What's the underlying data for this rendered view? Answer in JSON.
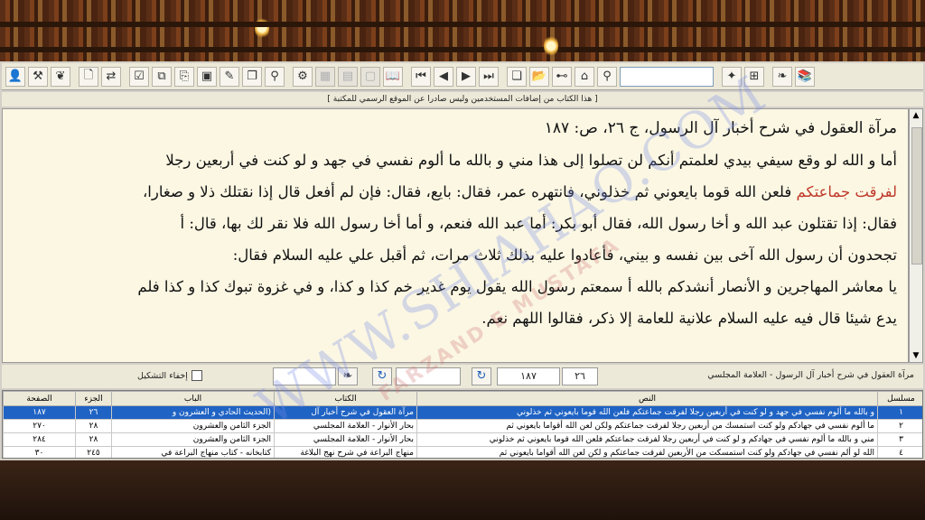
{
  "toolbar": {
    "icons": [
      "book-icon",
      "books-icon",
      "search-input-field",
      "pages-icon",
      "binoculars-icon",
      "grid-icon",
      "folder-icon",
      "copy-window-icon",
      "last-icon",
      "next-icon",
      "prev-icon",
      "first-icon",
      "open-book-icon",
      "blank",
      "blank",
      "settings-icon",
      "share-icon",
      "copy-icon",
      "pen-icon",
      "image-icon",
      "export-icon",
      "copy2-icon",
      "check-icon",
      "replace-icon",
      "new-icon",
      "leaf-icon",
      "tools-icon",
      "sheikh-icon"
    ],
    "search_value": ""
  },
  "notice": "[ هذا الكتاب من إضافات المستخدمين وليس صادرا عن الموقع الرسمي للمكتبة ]",
  "reader": {
    "heading": "مرآة العقول في شرح أخبار آل الرسول، ج ٢٦، ص: ١٨٧",
    "p1": "أما و الله لو وقع سيفي بيدي لعلمتم أنكم لن تصلوا إلى هذا مني و بالله ما ألوم نفسي في جهد و لو كنت في أربعين رجلا",
    "p2_red": "لفرقت جماعتكم",
    "p2_rest": " فلعن الله قوما بايعوني ثم خذلوني، فانتهره عمر، فقال: بايع، فقال: فإن لم أفعل قال إذا نقتلك ذلا و صغارا،",
    "p3": "فقال: إذا تقتلون عبد الله و أخا رسول الله، فقال أبو بكر: أما عبد الله فنعم، و أما أخا رسول الله فلا نقر لك بها، قال: أ",
    "p4": "تجحدون أن رسول الله آخى بين نفسه و بيني، فأعادوا عليه بذلك ثلاث مرات، ثم أقبل علي عليه السلام فقال:",
    "p5": "يا معاشر المهاجرين و الأنصار أنشدكم بالله أ سمعتم رسول الله يقول يوم غدير خم كذا و كذا، و في غزوة تبوك كذا و كذا فلم",
    "p6": "يدع شيئا قال فيه عليه السلام علانية للعامة إلا ذكر، فقالوا اللهم نعم."
  },
  "status": {
    "reference": "مرآة العقول في شرح أخبار آل الرسول - العلامة المجلسي",
    "volume": "٢٦",
    "page": "١٨٧",
    "hide_diacritics_label": "إخفاء التشكيل"
  },
  "grid": {
    "headers": [
      "مسلسل",
      "النص",
      "الكتاب",
      "الباب",
      "الجزء",
      "الصفحة"
    ],
    "rows": [
      [
        "١",
        "و بالله ما ألوم نفسي في جهد و لو كنت في أربعين رجلا لفرقت جماعتكم فلعن الله قوما بايعوني ثم خذلوني",
        "مرآة العقول في شرح أخبار آل",
        "(الحديث الحادي و العشرون و",
        "٢٦",
        "١٨٧"
      ],
      [
        "٢",
        "ما ألوم نفسي في جهادكم ولو كنت استمسك من أربعين رجلا لفرقت جماعتكم ولكن لعن الله أقواما بايعوني ثم",
        "بحار الأنوار - العلامة المجلسي",
        "الجزء الثامن والعشرون",
        "٢٨",
        "٢٧٠"
      ],
      [
        "٣",
        "مني و بالله ما ألوم نفسي في جهادكم و لو كنت في أربعين رجلا لفرقت جماعتكم فلعن الله قوما بايعوني ثم خذلوني",
        "بحار الأنوار - العلامة المجلسي",
        "الجزء الثامن والعشرون",
        "٢٨",
        "٢٨٤"
      ],
      [
        "٤",
        "الله لو ألم نفسي في جهادكم ولو كنت استمسكت من الأربعين لفرقت جماعتكم و لكن لعن الله أقواما بايعوني ثم",
        "منهاج البراعة في شرح نهج البلاغة",
        "كتابخانه - كتاب منهاج البراعة في",
        "٢٤٥",
        "٣٠"
      ]
    ]
  },
  "watermark": {
    "main": "WWW.SHIAHAQ.COM",
    "sub": "FARZAND E MUSTAFA"
  }
}
